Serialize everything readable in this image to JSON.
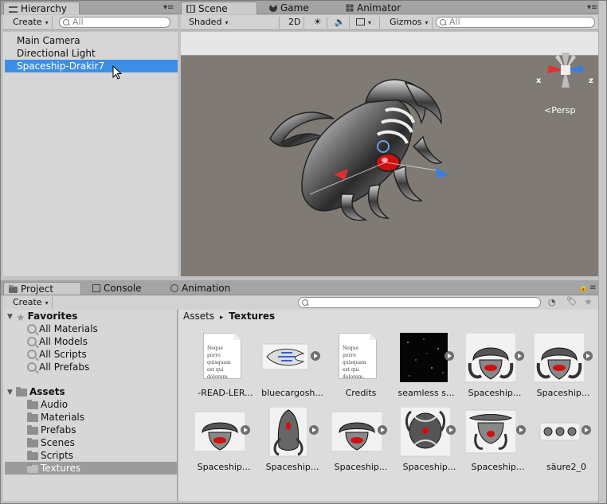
{
  "hierarchy": {
    "tab_label": "Hierarchy",
    "create_label": "Create",
    "search_placeholder": "All",
    "items": [
      "Main Camera",
      "Directional Light",
      "Spaceship-Drakir7"
    ],
    "selected_index": 2
  },
  "scene": {
    "tabs": [
      "Scene",
      "Game",
      "Animator"
    ],
    "active_tab": "Scene",
    "toolbar": {
      "shading": "Shaded",
      "mode_2d": "2D",
      "gizmos": "Gizmos",
      "search_placeholder": "All"
    },
    "gizmo": {
      "x_label": "x",
      "z_label": "z",
      "projection": "Persp"
    }
  },
  "project": {
    "tabs": [
      "Project",
      "Console",
      "Animation"
    ],
    "active_tab": "Project",
    "create_label": "Create",
    "favorites": {
      "label": "Favorites",
      "items": [
        "All Materials",
        "All Models",
        "All Scripts",
        "All Prefabs"
      ]
    },
    "assets": {
      "label": "Assets",
      "folders": [
        "Audio",
        "Materials",
        "Prefabs",
        "Scenes",
        "Scripts",
        "Textures"
      ],
      "selected_folder": "Textures"
    },
    "breadcrumb": {
      "root": "Assets",
      "separator": "▸",
      "current": "Textures"
    },
    "doc_preview_text": "Neque porro quisquam est qui dolorem.",
    "files": [
      {
        "label": "-READ-LER...",
        "kind": "doc"
      },
      {
        "label": "bluecargosh...",
        "kind": "sprite-blue"
      },
      {
        "label": "Credits",
        "kind": "doc"
      },
      {
        "label": "seamless s...",
        "kind": "stars"
      },
      {
        "label": "Spaceship...",
        "kind": "ship"
      },
      {
        "label": "Spaceship...",
        "kind": "ship"
      },
      {
        "label": "Spaceship...",
        "kind": "ship"
      },
      {
        "label": "Spaceship...",
        "kind": "ship-top"
      },
      {
        "label": "Spaceship...",
        "kind": "ship"
      },
      {
        "label": "Spaceship...",
        "kind": "ship-round"
      },
      {
        "label": "Spaceship...",
        "kind": "ship-wide"
      },
      {
        "label": "säure2_0",
        "kind": "dots"
      }
    ]
  },
  "colors": {
    "selection": "#3d8ee6",
    "scene_bg": "#807a74",
    "gizmo_x": "#e03030",
    "gizmo_z": "#3a7fe0"
  }
}
